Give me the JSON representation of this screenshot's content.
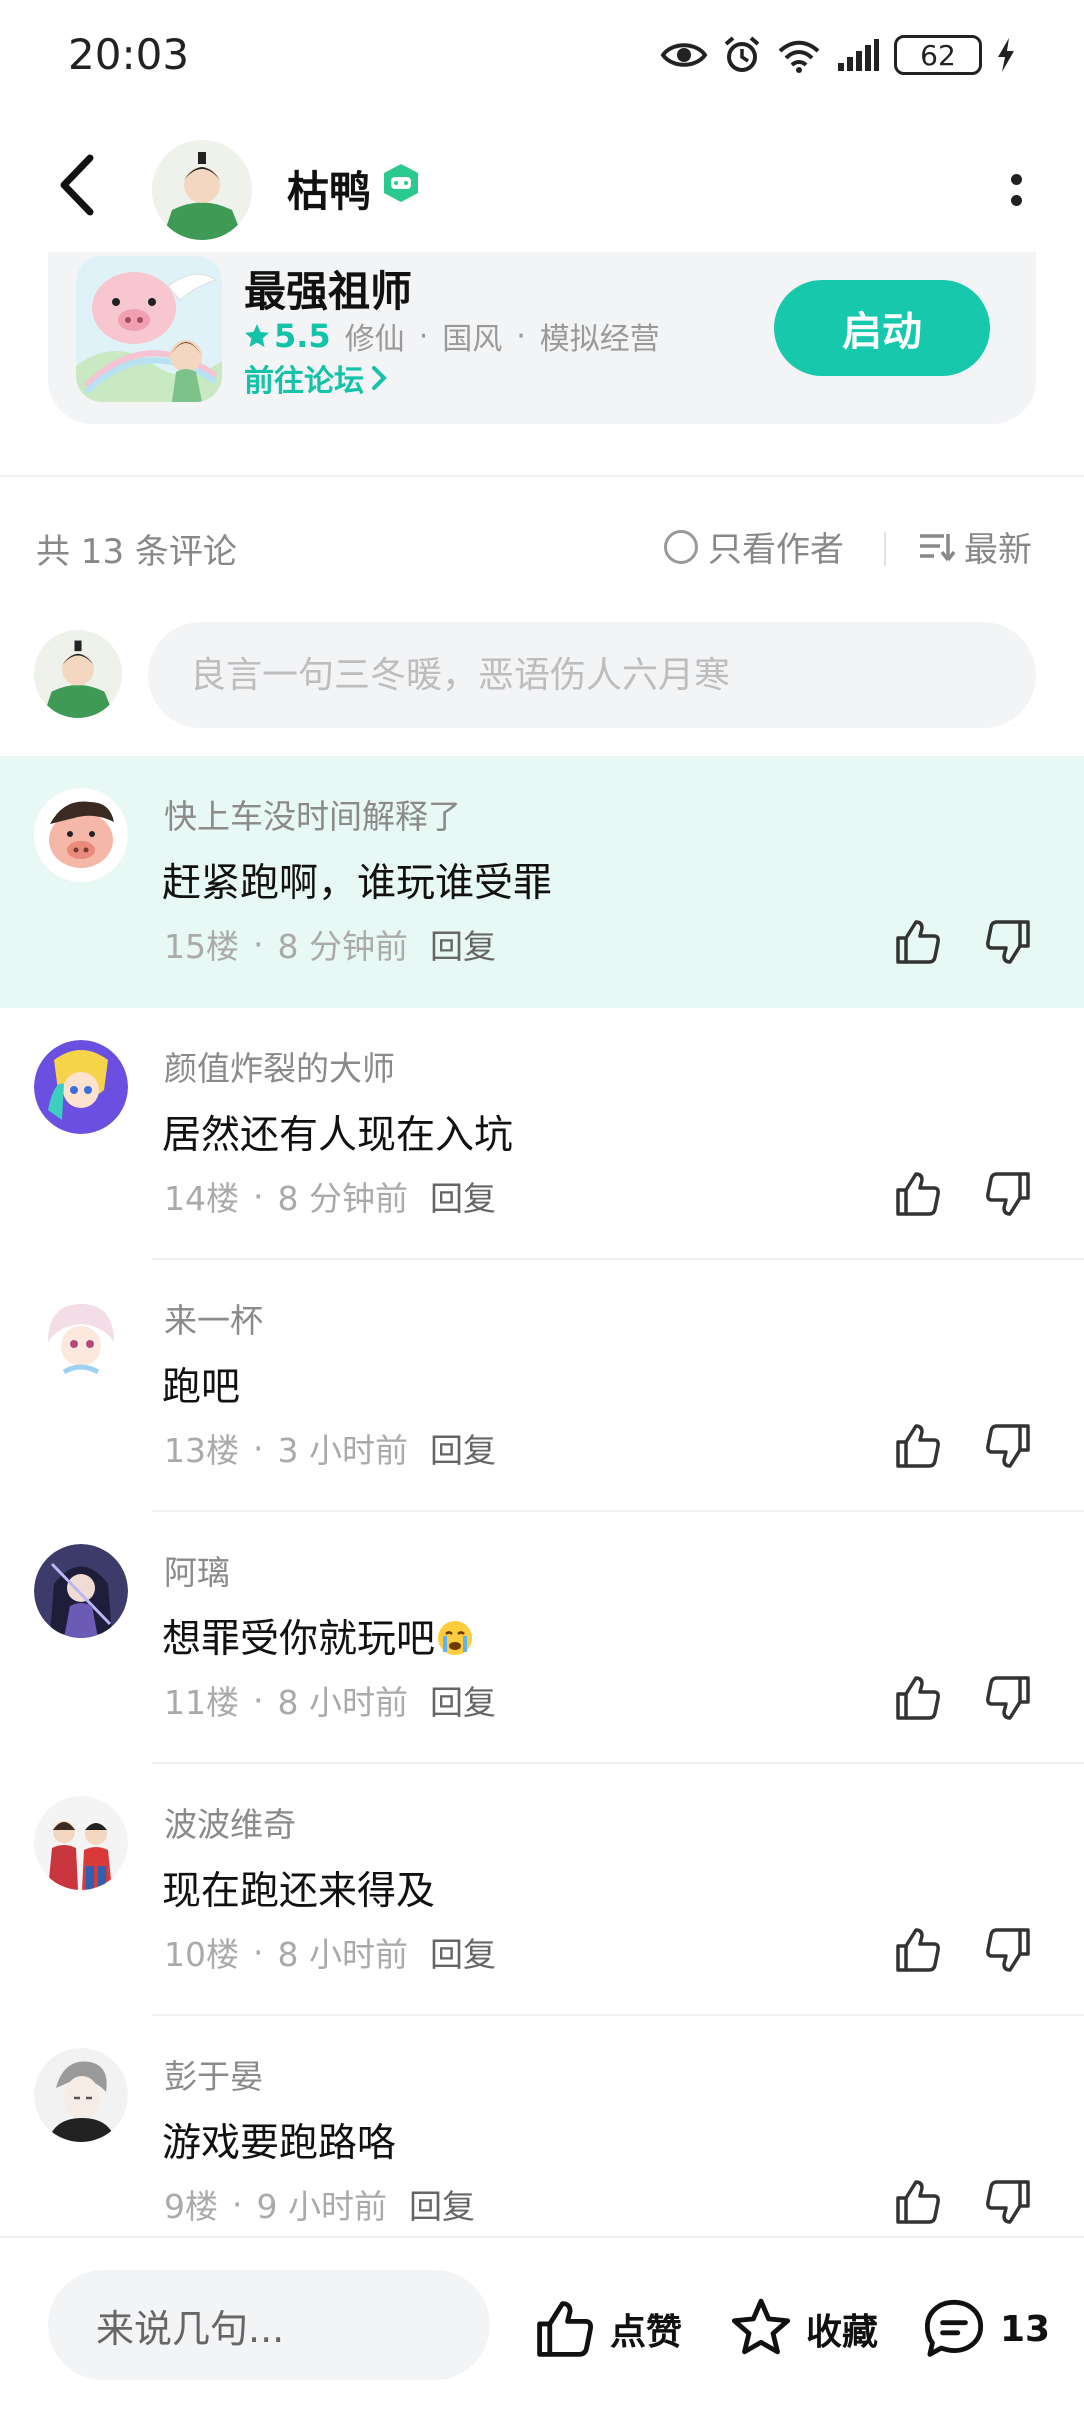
{
  "status_bar": {
    "time": "20:03",
    "battery": "62"
  },
  "header": {
    "user_name": "枯鸭"
  },
  "game": {
    "title": "最强祖师",
    "rating": "5.5",
    "tags": [
      "修仙",
      "国风",
      "模拟经营"
    ],
    "forum_link": "前往论坛",
    "launch_label": "启动"
  },
  "comments_header": {
    "count_text": "共 13 条评论",
    "only_author": "只看作者",
    "sort": "最新"
  },
  "input": {
    "placeholder": "良言一句三冬暖，恶语伤人六月寒"
  },
  "comments": [
    {
      "user": "快上车没时间解释了",
      "text": "赶紧跑啊，谁玩谁受罪",
      "floor": "15楼",
      "time": "8 分钟前",
      "reply": "回复"
    },
    {
      "user": "颜值炸裂的大师",
      "text": "居然还有人现在入坑",
      "floor": "14楼",
      "time": "8 分钟前",
      "reply": "回复"
    },
    {
      "user": "来一杯",
      "text": "跑吧",
      "floor": "13楼",
      "time": "3 小时前",
      "reply": "回复"
    },
    {
      "user": "阿璃",
      "text": "想罪受你就玩吧",
      "floor": "11楼",
      "time": "8 小时前",
      "reply": "回复"
    },
    {
      "user": "波波维奇",
      "text": "现在跑还来得及",
      "floor": "10楼",
      "time": "8 小时前",
      "reply": "回复"
    },
    {
      "user": "彭于晏",
      "text": "游戏要跑路咯",
      "floor": "9楼",
      "time": "9 小时前",
      "reply": "回复"
    }
  ],
  "bottom_bar": {
    "input_placeholder": "来说几句...",
    "like_label": "点赞",
    "favorite_label": "收藏",
    "comment_count": "13"
  },
  "colors": {
    "accent": "#18c8ad",
    "highlight_bg": "#e8f8f5"
  }
}
